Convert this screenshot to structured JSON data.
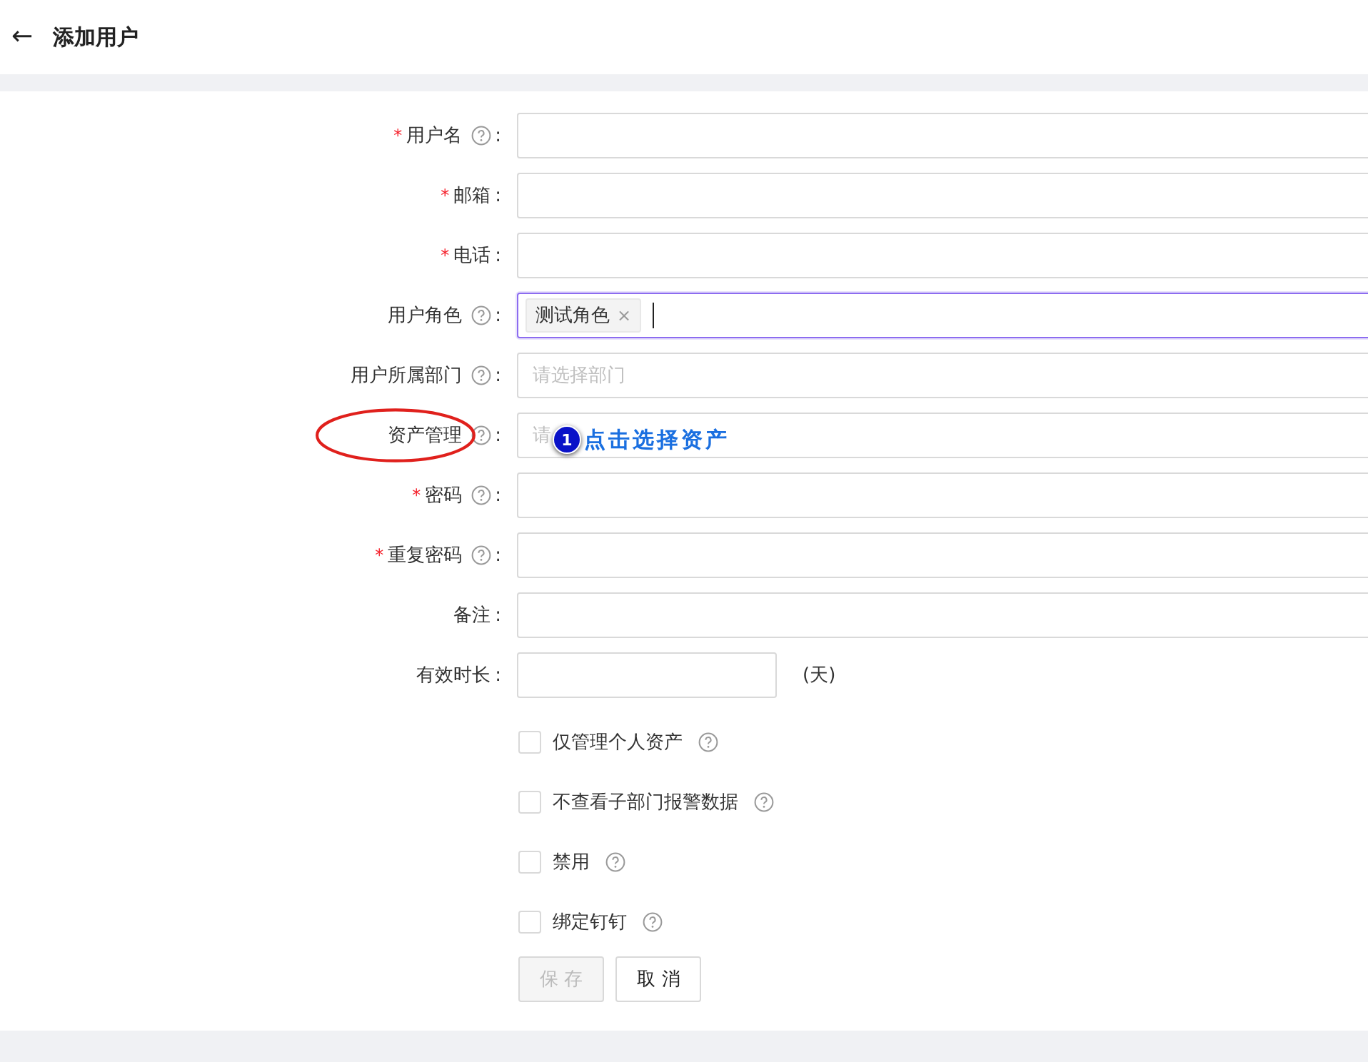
{
  "header": {
    "back": "←",
    "title": "添加用户"
  },
  "fields": [
    {
      "kind": "text",
      "required_mark": "*",
      "label": "用户名",
      "help": true,
      "colon": ":"
    },
    {
      "kind": "text",
      "required_mark": "*",
      "label": "邮箱",
      "help": false,
      "colon": ":"
    },
    {
      "kind": "text",
      "required_mark": "*",
      "label": "电话",
      "help": false,
      "colon": ":"
    },
    {
      "kind": "tags",
      "label": "用户角色",
      "help": true,
      "colon": ":",
      "focused": true,
      "tags": [
        {
          "label": "测试角色",
          "remove": "×"
        }
      ]
    },
    {
      "kind": "select",
      "label": "用户所属部门",
      "help": true,
      "colon": ":",
      "placeholder": "请选择部门"
    },
    {
      "kind": "select",
      "label": "资产管理",
      "help": true,
      "colon": ":",
      "placeholder": "请",
      "annotated": true
    },
    {
      "kind": "text",
      "required_mark": "*",
      "label": "密码",
      "help": true,
      "colon": ":"
    },
    {
      "kind": "text",
      "required_mark": "*",
      "label": "重复密码",
      "help": true,
      "colon": ":"
    },
    {
      "kind": "text",
      "label": "备注",
      "help": false,
      "colon": ":"
    },
    {
      "kind": "duration",
      "label": "有效时长",
      "help": false,
      "colon": ":",
      "unit": "(天)"
    }
  ],
  "checkboxes": [
    {
      "label": "仅管理个人资产",
      "checked": false,
      "help": true
    },
    {
      "label": "不查看子部门报警数据",
      "checked": false,
      "help": true
    },
    {
      "label": "禁用",
      "checked": false,
      "help": true
    },
    {
      "label": "绑定钉钉",
      "checked": false,
      "help": true
    }
  ],
  "buttons": [
    {
      "label": "保 存",
      "disabled": true
    },
    {
      "label": "取 消",
      "disabled": false
    }
  ],
  "annotation": {
    "number": "1",
    "text": "点击选择资产"
  }
}
